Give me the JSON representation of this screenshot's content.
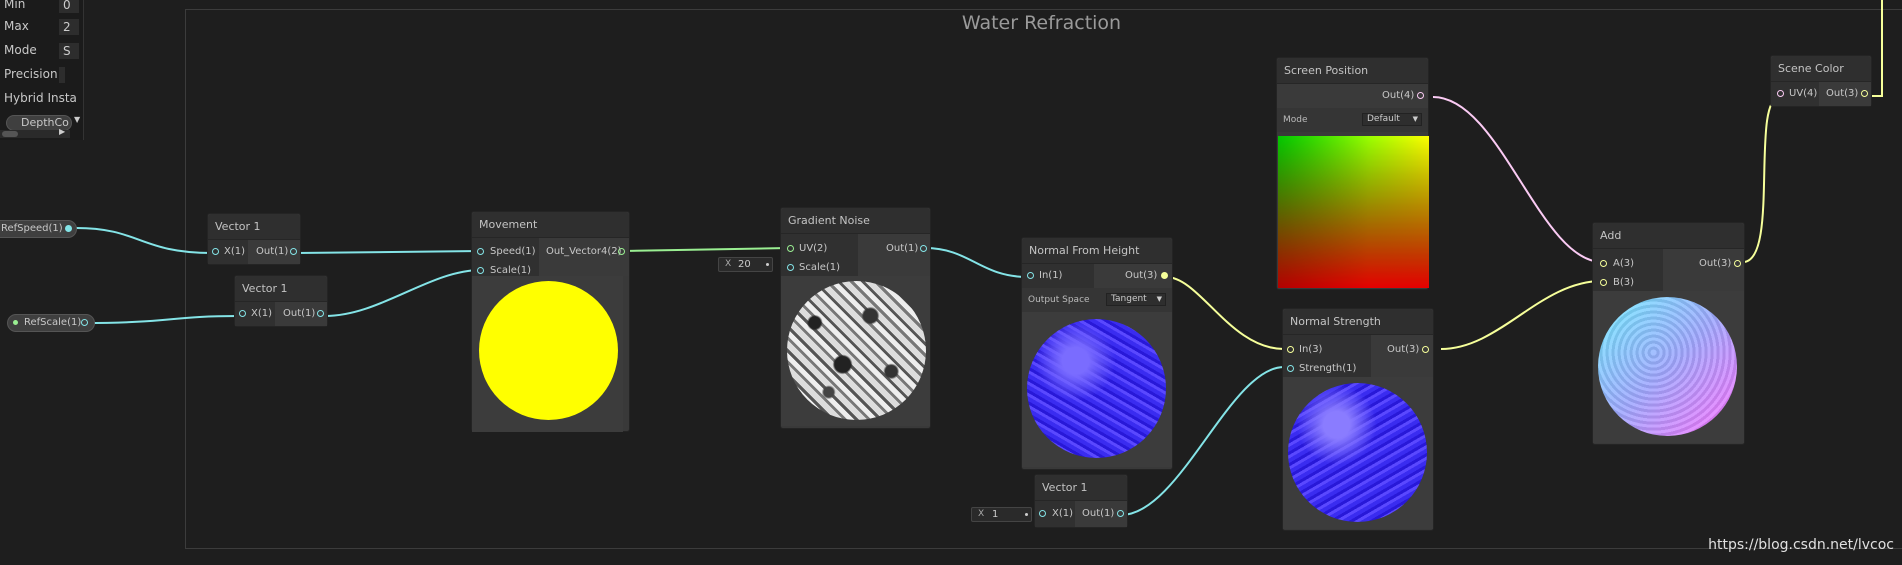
{
  "graph": {
    "group_title": "Water Refraction",
    "watermark": "https://blog.csdn.net/lvcoc"
  },
  "left_panel": {
    "rows": [
      {
        "label": "Min",
        "value": "0"
      },
      {
        "label": "Max",
        "value": "2"
      },
      {
        "label": "Mode",
        "value": "S"
      },
      {
        "label": "Precision",
        "value": ""
      },
      {
        "label": "Hybrid Insta",
        "value": ""
      }
    ],
    "blackboard_item": "DepthCo"
  },
  "properties": {
    "ref_speed": "RefSpeed(1)",
    "ref_scale": "RefScale(1)"
  },
  "nodes": {
    "vector1_a": {
      "title": "Vector 1",
      "in": "X(1)",
      "out": "Out(1)"
    },
    "vector1_b": {
      "title": "Vector 1",
      "in": "X(1)",
      "out": "Out(1)"
    },
    "movement": {
      "title": "Movement",
      "in1": "Speed(1)",
      "in2": "Scale(1)",
      "out": "Out_Vector4(2)"
    },
    "gradient_noise": {
      "title": "Gradient Noise",
      "in1": "UV(2)",
      "in2": "Scale(1)",
      "out": "Out(1)",
      "scale_x_label": "X",
      "scale_x_value": "20"
    },
    "normal_from_height": {
      "title": "Normal From Height",
      "in": "In(1)",
      "out": "Out(3)",
      "option_label": "Output Space",
      "option_value": "Tangent"
    },
    "screen_position": {
      "title": "Screen Position",
      "out": "Out(4)",
      "option_label": "Mode",
      "option_value": "Default"
    },
    "normal_strength": {
      "title": "Normal Strength",
      "in1": "In(3)",
      "in2": "Strength(1)",
      "out": "Out(3)"
    },
    "vector1_c": {
      "title": "Vector 1",
      "in": "X(1)",
      "out": "Out(1)",
      "x_label": "X",
      "x_value": "1"
    },
    "add": {
      "title": "Add",
      "in1": "A(3)",
      "in2": "B(3)",
      "out": "Out(3)"
    },
    "scene_color": {
      "title": "Scene Color",
      "in": "UV(4)",
      "out": "Out(3)"
    }
  },
  "colors": {
    "float_port": "#84e4e7",
    "vec2_port": "#9aef92",
    "vec3_port": "#f6ff9a",
    "vec4_port": "#fbcbf4",
    "background": "#1e1e1e",
    "node": "#393939"
  }
}
